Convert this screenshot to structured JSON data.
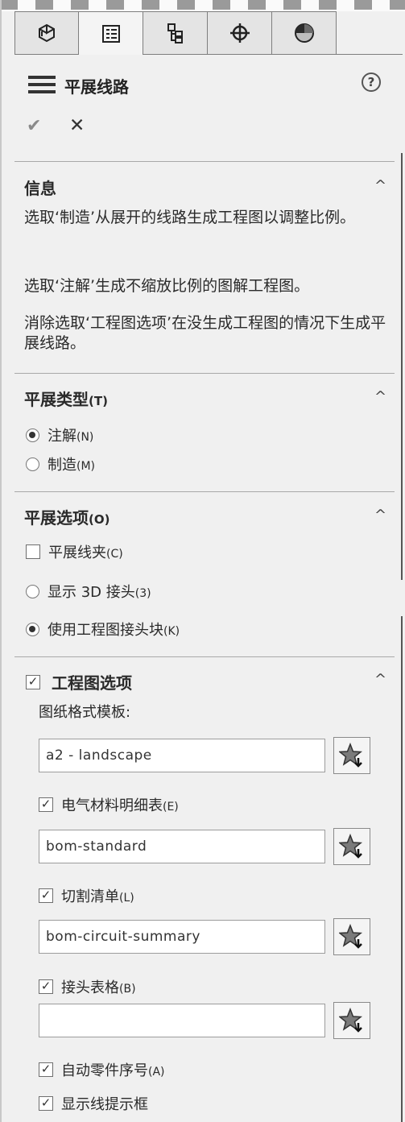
{
  "header": {
    "title": "平展线路",
    "help_symbol": "?"
  },
  "actions": {
    "ok_symbol": "✔",
    "cancel_symbol": "✕"
  },
  "tabs": [
    {
      "name": "featuremanager-tab-icon"
    },
    {
      "name": "propertymanager-tab-icon"
    },
    {
      "name": "configurationmanager-tab-icon"
    },
    {
      "name": "dimxpert-tab-icon"
    },
    {
      "name": "appearance-tab-icon"
    }
  ],
  "info": {
    "title": "信息",
    "paragraphs": [
      "选取‘制造’从展开的线路生成工程图以调整比例。",
      "选取‘注解’生成不缩放比例的图解工程图。",
      "消除选取‘工程图选项’在没生成工程图的情况下生成平展线路。"
    ]
  },
  "flatten_type": {
    "title": "平展类型",
    "title_key": "(T)",
    "options": [
      {
        "label": "注解",
        "key": "(N)",
        "selected": true
      },
      {
        "label": "制造",
        "key": "(M)",
        "selected": false
      }
    ]
  },
  "flatten_options": {
    "title": "平展选项",
    "title_key": "(O)",
    "clip": {
      "label": "平展线夹",
      "key": "(C)",
      "checked": false
    },
    "show3d": {
      "label": "显示 3D 接头",
      "key": "(3)",
      "selected": false
    },
    "useblock": {
      "label": "使用工程图接头块",
      "key": "(K)",
      "selected": true
    }
  },
  "drawing_options": {
    "title": "工程图选项",
    "checked": true,
    "sheet_format_label": "图纸格式模板:",
    "sheet_format_value": "a2 - landscape",
    "bom": {
      "label": "电气材料明细表",
      "key": "(E)",
      "checked": true,
      "value": "bom-standard"
    },
    "cutlist": {
      "label": "切割清单",
      "key": "(L)",
      "checked": true,
      "value": "bom-circuit-summary"
    },
    "connector_table": {
      "label": "接头表格",
      "key": "(B)",
      "checked": true,
      "value": ""
    },
    "auto_balloon": {
      "label": "自动零件序号",
      "key": "(A)",
      "checked": true
    },
    "show_callouts": {
      "label": "显示线提示框",
      "checked": true
    }
  },
  "ui": {
    "checkmark": "✓",
    "caret": "^"
  }
}
